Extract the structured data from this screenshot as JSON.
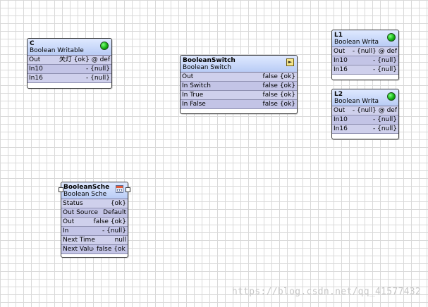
{
  "nodes": {
    "c": {
      "name": "C",
      "type": "Boolean Writable",
      "slots": [
        {
          "name": "Out",
          "value": "关灯 {ok} @ def"
        },
        {
          "name": "In10",
          "value": "- {null}"
        },
        {
          "name": "In16",
          "value": "- {null}"
        }
      ]
    },
    "booleanswitch": {
      "name": "BooleanSwitch",
      "type": "Boolean Switch",
      "slots": [
        {
          "name": "Out",
          "value": "false {ok}"
        },
        {
          "name": "In Switch",
          "value": "false {ok}"
        },
        {
          "name": "In True",
          "value": "false {ok}"
        },
        {
          "name": "In False",
          "value": "false {ok}"
        }
      ]
    },
    "l1": {
      "name": "L1",
      "type": "Boolean Writa",
      "slots": [
        {
          "name": "Out",
          "value": "- {null} @ def"
        },
        {
          "name": "In10",
          "value": "- {null}"
        },
        {
          "name": "In16",
          "value": "- {null}"
        }
      ]
    },
    "l2": {
      "name": "L2",
      "type": "Boolean Writa",
      "slots": [
        {
          "name": "Out",
          "value": "- {null} @ def"
        },
        {
          "name": "In10",
          "value": "- {null}"
        },
        {
          "name": "In16",
          "value": "- {null}"
        }
      ]
    },
    "booleanschedule": {
      "name": "BooleanSche",
      "type": "Boolean Sche",
      "slots": [
        {
          "name": "Status",
          "value": "{ok}"
        },
        {
          "name": "Out Source",
          "value": "Default"
        },
        {
          "name": "Out",
          "value": "false {ok}"
        },
        {
          "name": "In",
          "value": "- {null}"
        },
        {
          "name": "Next Time",
          "value": "null"
        },
        {
          "name": "Next Value",
          "value": "false {ok}"
        }
      ]
    }
  },
  "icons": {
    "status": "green-status-led-icon",
    "switch": "boolean-switch-icon",
    "schedule": "calendar-icon"
  },
  "watermark": "https://blog.csdn.net/qq_41577432"
}
